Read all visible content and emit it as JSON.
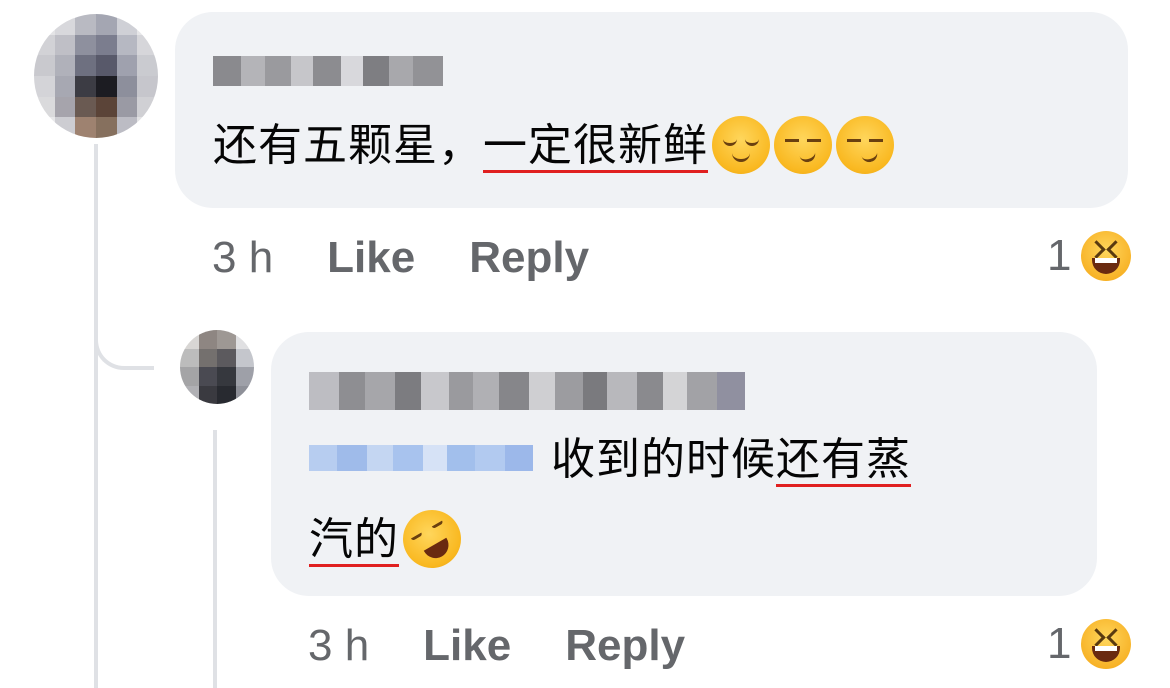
{
  "comment": {
    "text_plain": "还有五颗星，",
    "text_underlined": "一定很新鲜",
    "emojis": [
      "relieved-face",
      "smirking-face",
      "smirking-face"
    ],
    "time": "3 h",
    "like_label": "Like",
    "reply_label": "Reply",
    "reaction_count": "1",
    "reaction_emoji": "laughing-face"
  },
  "reply": {
    "text_plain": "收到的时候",
    "text_underlined_1": "还有蒸",
    "text_underlined_2": "汽的",
    "emoji": "rolling-on-floor-laughing",
    "time": "3 h",
    "like_label": "Like",
    "reply_label": "Reply",
    "reaction_count": "1",
    "reaction_emoji": "laughing-face"
  },
  "colors": {
    "bubble": "#f0f2f5",
    "meta_text": "#65676b",
    "underline": "#e02020",
    "mention": "#a8c3ee"
  }
}
